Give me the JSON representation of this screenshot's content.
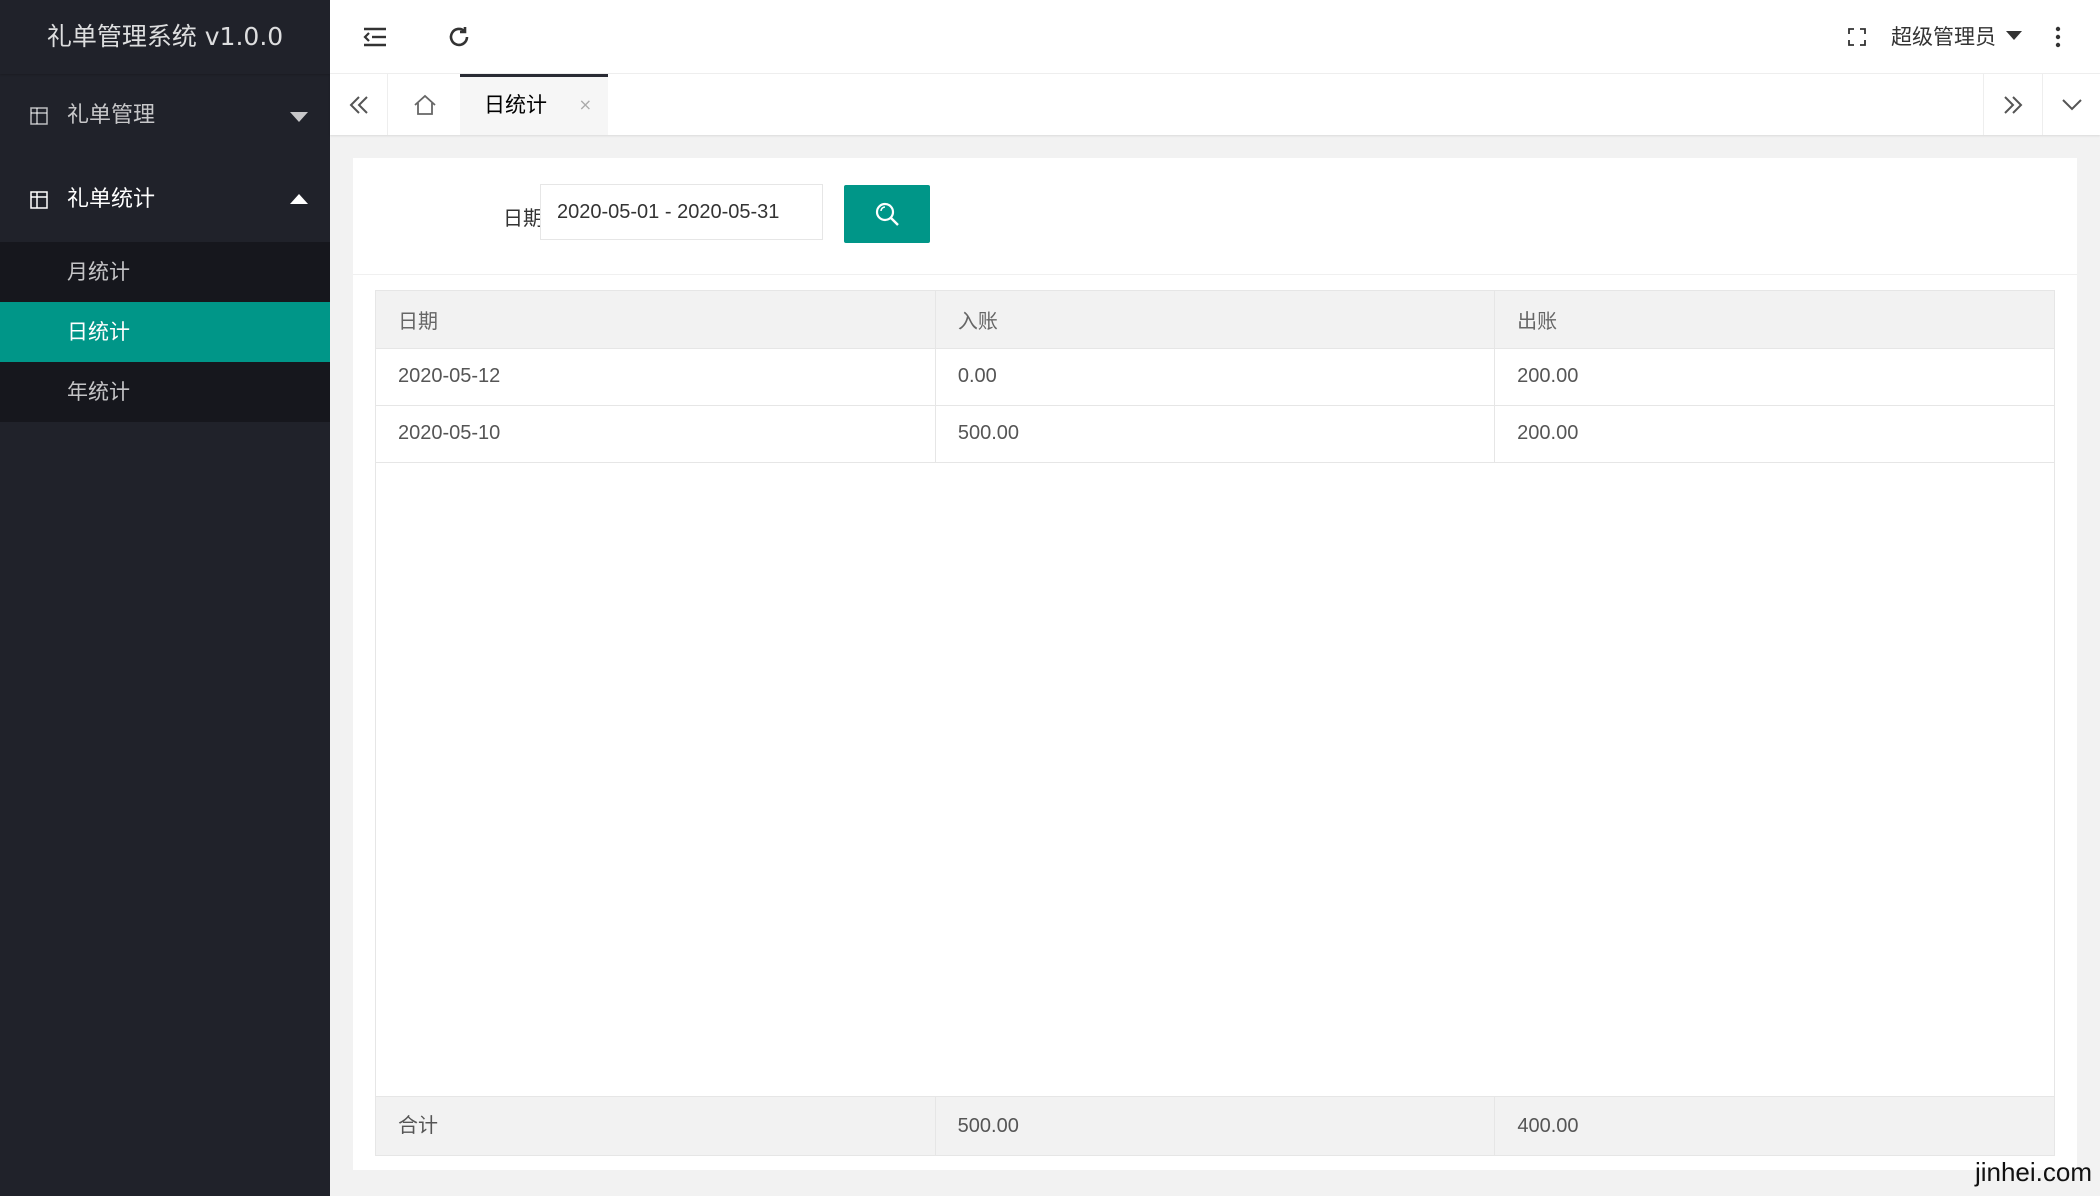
{
  "app": {
    "title": "礼单管理系统 v1.0.0"
  },
  "sidebar": {
    "groups": [
      {
        "label": "礼单管理",
        "expanded": false
      },
      {
        "label": "礼单统计",
        "expanded": true,
        "items": [
          {
            "label": "月统计",
            "active": false
          },
          {
            "label": "日统计",
            "active": true
          },
          {
            "label": "年统计",
            "active": false
          }
        ]
      }
    ]
  },
  "header": {
    "user": "超级管理员"
  },
  "tabs": {
    "current": "日统计",
    "close": "×"
  },
  "filter": {
    "label": "日期",
    "date_range": "2020-05-01 - 2020-05-31"
  },
  "table": {
    "headers": [
      "日期",
      "入账",
      "出账"
    ],
    "rows": [
      [
        "2020-05-12",
        "0.00",
        "200.00"
      ],
      [
        "2020-05-10",
        "500.00",
        "200.00"
      ]
    ],
    "total": [
      "合计",
      "500.00",
      "400.00"
    ]
  },
  "watermark": "jinhei.com",
  "colors": {
    "sidebar_bg": "#20222a",
    "accent": "#009688"
  }
}
